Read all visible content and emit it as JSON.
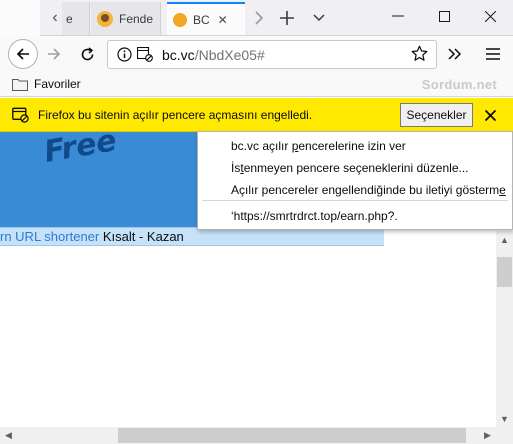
{
  "tabs": [
    {
      "label": "e"
    },
    {
      "label": "Fende"
    },
    {
      "label": "BC"
    }
  ],
  "navbar": {
    "url_domain": "bc.vc",
    "url_path": "/NbdXe05#"
  },
  "bookmarks": {
    "folder_label": "Favoriler",
    "watermark": "Sordum.net"
  },
  "notification": {
    "message": "Firefox bu sitenin açılır pencere açmasını engelledi.",
    "options_label": "Seçenekler"
  },
  "page": {
    "banner_text": "Free",
    "link_text": "rn URL shortener",
    "link_suffix": " Kısalt - Kazan"
  },
  "menu": {
    "items": [
      {
        "pre": "bc.vc açılır ",
        "u": "p",
        "post": "encerelerine izin ver"
      },
      {
        "pre": "İs",
        "u": "t",
        "post": "enmeyen pencere seçeneklerini düzenle..."
      },
      {
        "pre": "Açılır pencereler engellendiğinde bu iletiyi gösterm",
        "u": "e",
        "post": ""
      },
      {
        "pre": "‘https://smrtrdrct.top/earn.php?.",
        "u": "",
        "post": ""
      }
    ]
  },
  "colors": {
    "notification_bg": "#ffe900",
    "banner_bg": "#3a8bd5",
    "link": "#2b7bd6",
    "active_tab_accent": "#0a84ff"
  }
}
